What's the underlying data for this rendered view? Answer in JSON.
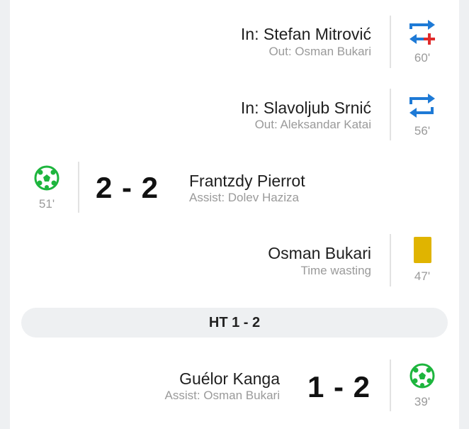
{
  "events": {
    "sub1": {
      "in": "In: Stefan Mitrović",
      "out": "Out: Osman Bukari",
      "minute": "60'"
    },
    "sub2": {
      "in": "In: Slavoljub Srnić",
      "out": "Out: Aleksandar Katai",
      "minute": "56'"
    },
    "goal1": {
      "minute": "51'",
      "score": "2 - 2",
      "scorer": "Frantzdy Pierrot",
      "assist": "Assist: Dolev Haziza"
    },
    "card1": {
      "player": "Osman Bukari",
      "reason": "Time wasting",
      "minute": "47'"
    },
    "halftime": {
      "label": "HT 1 - 2"
    },
    "goal2": {
      "scorer": "Guélor Kanga",
      "assist": "Assist: Osman Bukari",
      "score": "1 - 2",
      "minute": "39'"
    }
  },
  "colors": {
    "substitution_blue": "#1e7ad6",
    "substitution_red": "#e02b2b",
    "goal_green": "#1db53d",
    "yellow_card": "#e0b400"
  }
}
